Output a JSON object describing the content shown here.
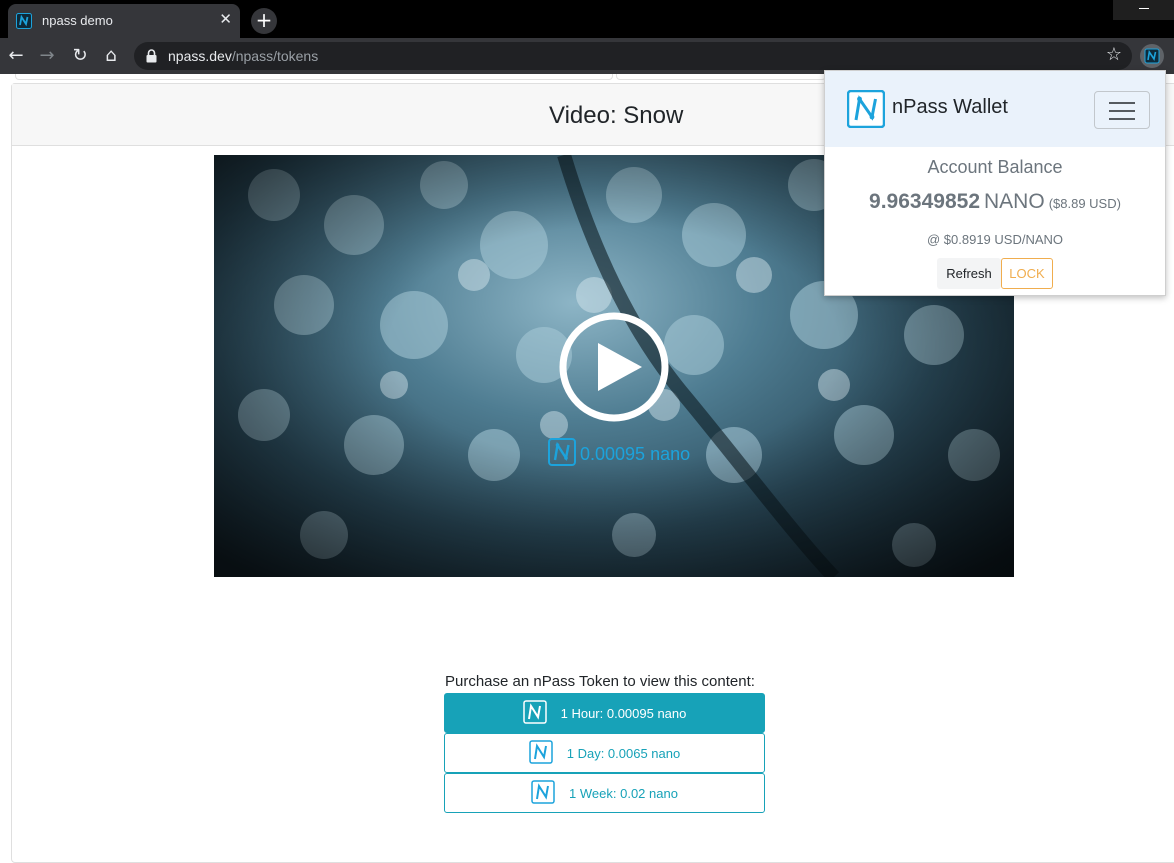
{
  "browser": {
    "tab_title": "npass demo",
    "tab_close": "✕",
    "new_tab": "+",
    "url_host": "npass.dev",
    "url_path": "/npass/tokens",
    "back": "←",
    "forward": "→",
    "reload": "↻",
    "home": "⌂",
    "star": "☆"
  },
  "page": {
    "title": "Video: Snow",
    "video": {
      "price": "0.00095 nano"
    },
    "purchase_label": "Purchase an nPass Token to view this content:",
    "tokens": [
      {
        "label": "1 Hour: 0.00095 nano",
        "selected": true
      },
      {
        "label": "1 Day: 0.0065 nano",
        "selected": false
      },
      {
        "label": "1 Week: 0.02 nano",
        "selected": false
      }
    ]
  },
  "wallet": {
    "title": "nPass Wallet",
    "balance_label": "Account Balance",
    "balance_amount": "9.96349852",
    "balance_unit": "NANO",
    "balance_usd": "($8.89 USD)",
    "rate": "@ $0.8919 USD/NANO",
    "refresh_label": "Refresh",
    "lock_label": "LOCK"
  },
  "colors": {
    "accent": "#17a2b8",
    "logo_blue": "#1ca3dc",
    "lock_orange": "#f0ad4e"
  }
}
